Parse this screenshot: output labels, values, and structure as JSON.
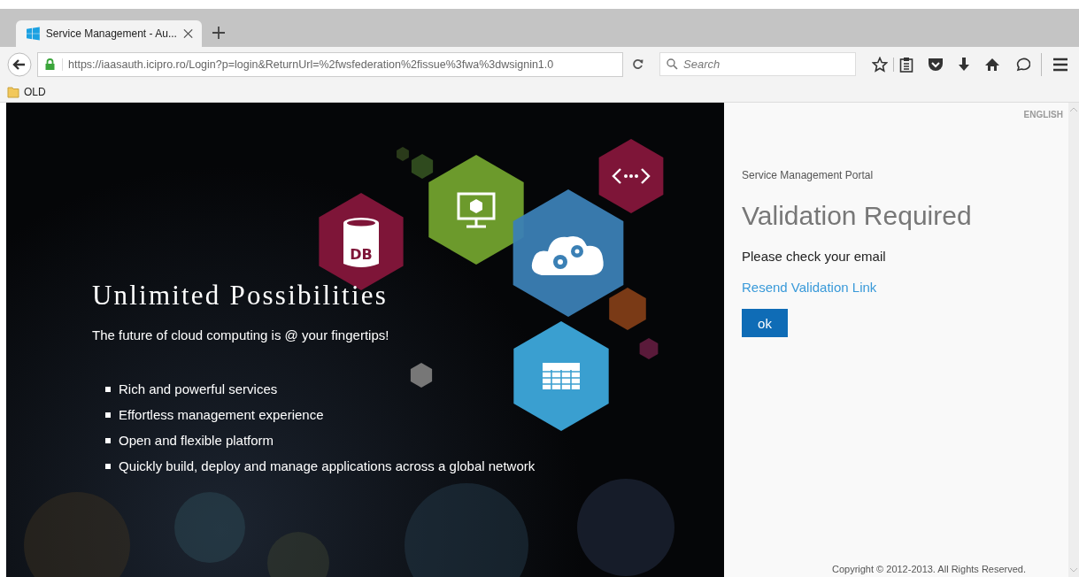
{
  "browser": {
    "tab": {
      "title": "Service Management - Au...",
      "selected": true
    },
    "url": "https://iaasauth.icipro.ro/Login?p=login&ReturnUrl=%2fwsfederation%2fissue%3fwa%3dwsignin1.0",
    "search": {
      "placeholder": "Search"
    },
    "bookmarks": [
      {
        "label": "OLD"
      }
    ]
  },
  "hero": {
    "title": "Unlimited Possibilities",
    "subtitle": "The future of cloud computing is @ your fingertips!",
    "features": [
      "Rich and powerful services",
      "Effortless management experience",
      "Open and flexible platform",
      "Quickly build, deploy and manage applications across a global network"
    ],
    "db_label": "DB"
  },
  "panel": {
    "language": "ENGLISH",
    "portal": "Service Management Portal",
    "heading": "Validation Required",
    "message": "Please check your email",
    "link": "Resend Validation Link",
    "button": "ok",
    "copyright": "Copyright © 2012-2013. All Rights Reserved."
  }
}
